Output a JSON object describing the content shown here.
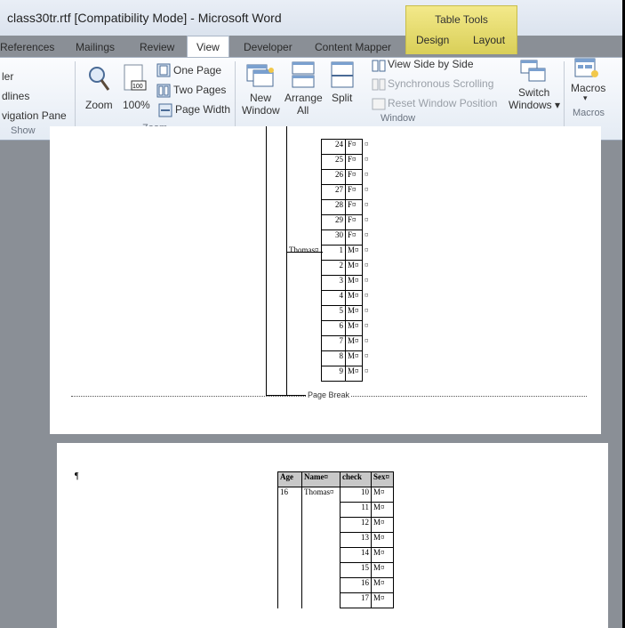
{
  "window": {
    "title": "class30tr.rtf [Compatibility Mode]  -  Microsoft Word"
  },
  "context_tab": {
    "label": "Table Tools"
  },
  "tabs": [
    {
      "label": "References"
    },
    {
      "label": "Mailings"
    },
    {
      "label": "Review"
    },
    {
      "label": "View"
    },
    {
      "label": "Developer"
    },
    {
      "label": "Content Mapper"
    },
    {
      "label": "Design"
    },
    {
      "label": "Layout"
    }
  ],
  "ribbon": {
    "show": {
      "ruler": "ler",
      "gridlines": "dlines",
      "nav_pane": "vigation Pane",
      "group": "Show"
    },
    "zoom": {
      "zoom": "Zoom",
      "hundred": "100%",
      "one_page": "One Page",
      "two_pages": "Two Pages",
      "page_width": "Page Width",
      "group": "Zoom"
    },
    "window": {
      "new_window_1": "New",
      "new_window_2": "Window",
      "arrange_1": "Arrange",
      "arrange_2": "All",
      "split": "Split",
      "side_by_side": "View Side by Side",
      "sync_scroll": "Synchronous Scrolling",
      "reset_pos": "Reset Window Position",
      "switch_1": "Switch",
      "switch_2": "Windows ▾",
      "group": "Window"
    },
    "macros": {
      "label": "Macros",
      "arrow": "▾",
      "group": "Macros"
    }
  },
  "document": {
    "page1_rows": [
      {
        "name": "",
        "num": "24",
        "sex": "F¤"
      },
      {
        "name": "",
        "num": "25",
        "sex": "F¤"
      },
      {
        "name": "",
        "num": "26",
        "sex": "F¤"
      },
      {
        "name": "",
        "num": "27",
        "sex": "F¤"
      },
      {
        "name": "",
        "num": "28",
        "sex": "F¤"
      },
      {
        "name": "",
        "num": "29",
        "sex": "F¤"
      },
      {
        "name": "",
        "num": "30",
        "sex": "F¤"
      },
      {
        "name": "Thomas¤",
        "num": "1",
        "sex": "M¤"
      },
      {
        "name": "",
        "num": "2",
        "sex": "M¤"
      },
      {
        "name": "",
        "num": "3",
        "sex": "M¤"
      },
      {
        "name": "",
        "num": "4",
        "sex": "M¤"
      },
      {
        "name": "",
        "num": "5",
        "sex": "M¤"
      },
      {
        "name": "",
        "num": "6",
        "sex": "M¤"
      },
      {
        "name": "",
        "num": "7",
        "sex": "M¤"
      },
      {
        "name": "",
        "num": "8",
        "sex": "M¤"
      },
      {
        "name": "",
        "num": "9",
        "sex": "M¤"
      }
    ],
    "cell_mark": "¤",
    "page_break": "Page Break",
    "pilcrow": "¶",
    "headers": [
      "Age",
      "Name¤",
      "check",
      "Sex¤"
    ],
    "page2_rows": [
      {
        "age": "16",
        "name": "Thomas¤",
        "num": "10",
        "sex": "M¤"
      },
      {
        "age": "",
        "name": "",
        "num": "11",
        "sex": "M¤"
      },
      {
        "age": "",
        "name": "",
        "num": "12",
        "sex": "M¤"
      },
      {
        "age": "",
        "name": "",
        "num": "13",
        "sex": "M¤"
      },
      {
        "age": "",
        "name": "",
        "num": "14",
        "sex": "M¤"
      },
      {
        "age": "",
        "name": "",
        "num": "15",
        "sex": "M¤"
      },
      {
        "age": "",
        "name": "",
        "num": "16",
        "sex": "M¤"
      },
      {
        "age": "",
        "name": "",
        "num": "17",
        "sex": "M¤"
      }
    ]
  }
}
